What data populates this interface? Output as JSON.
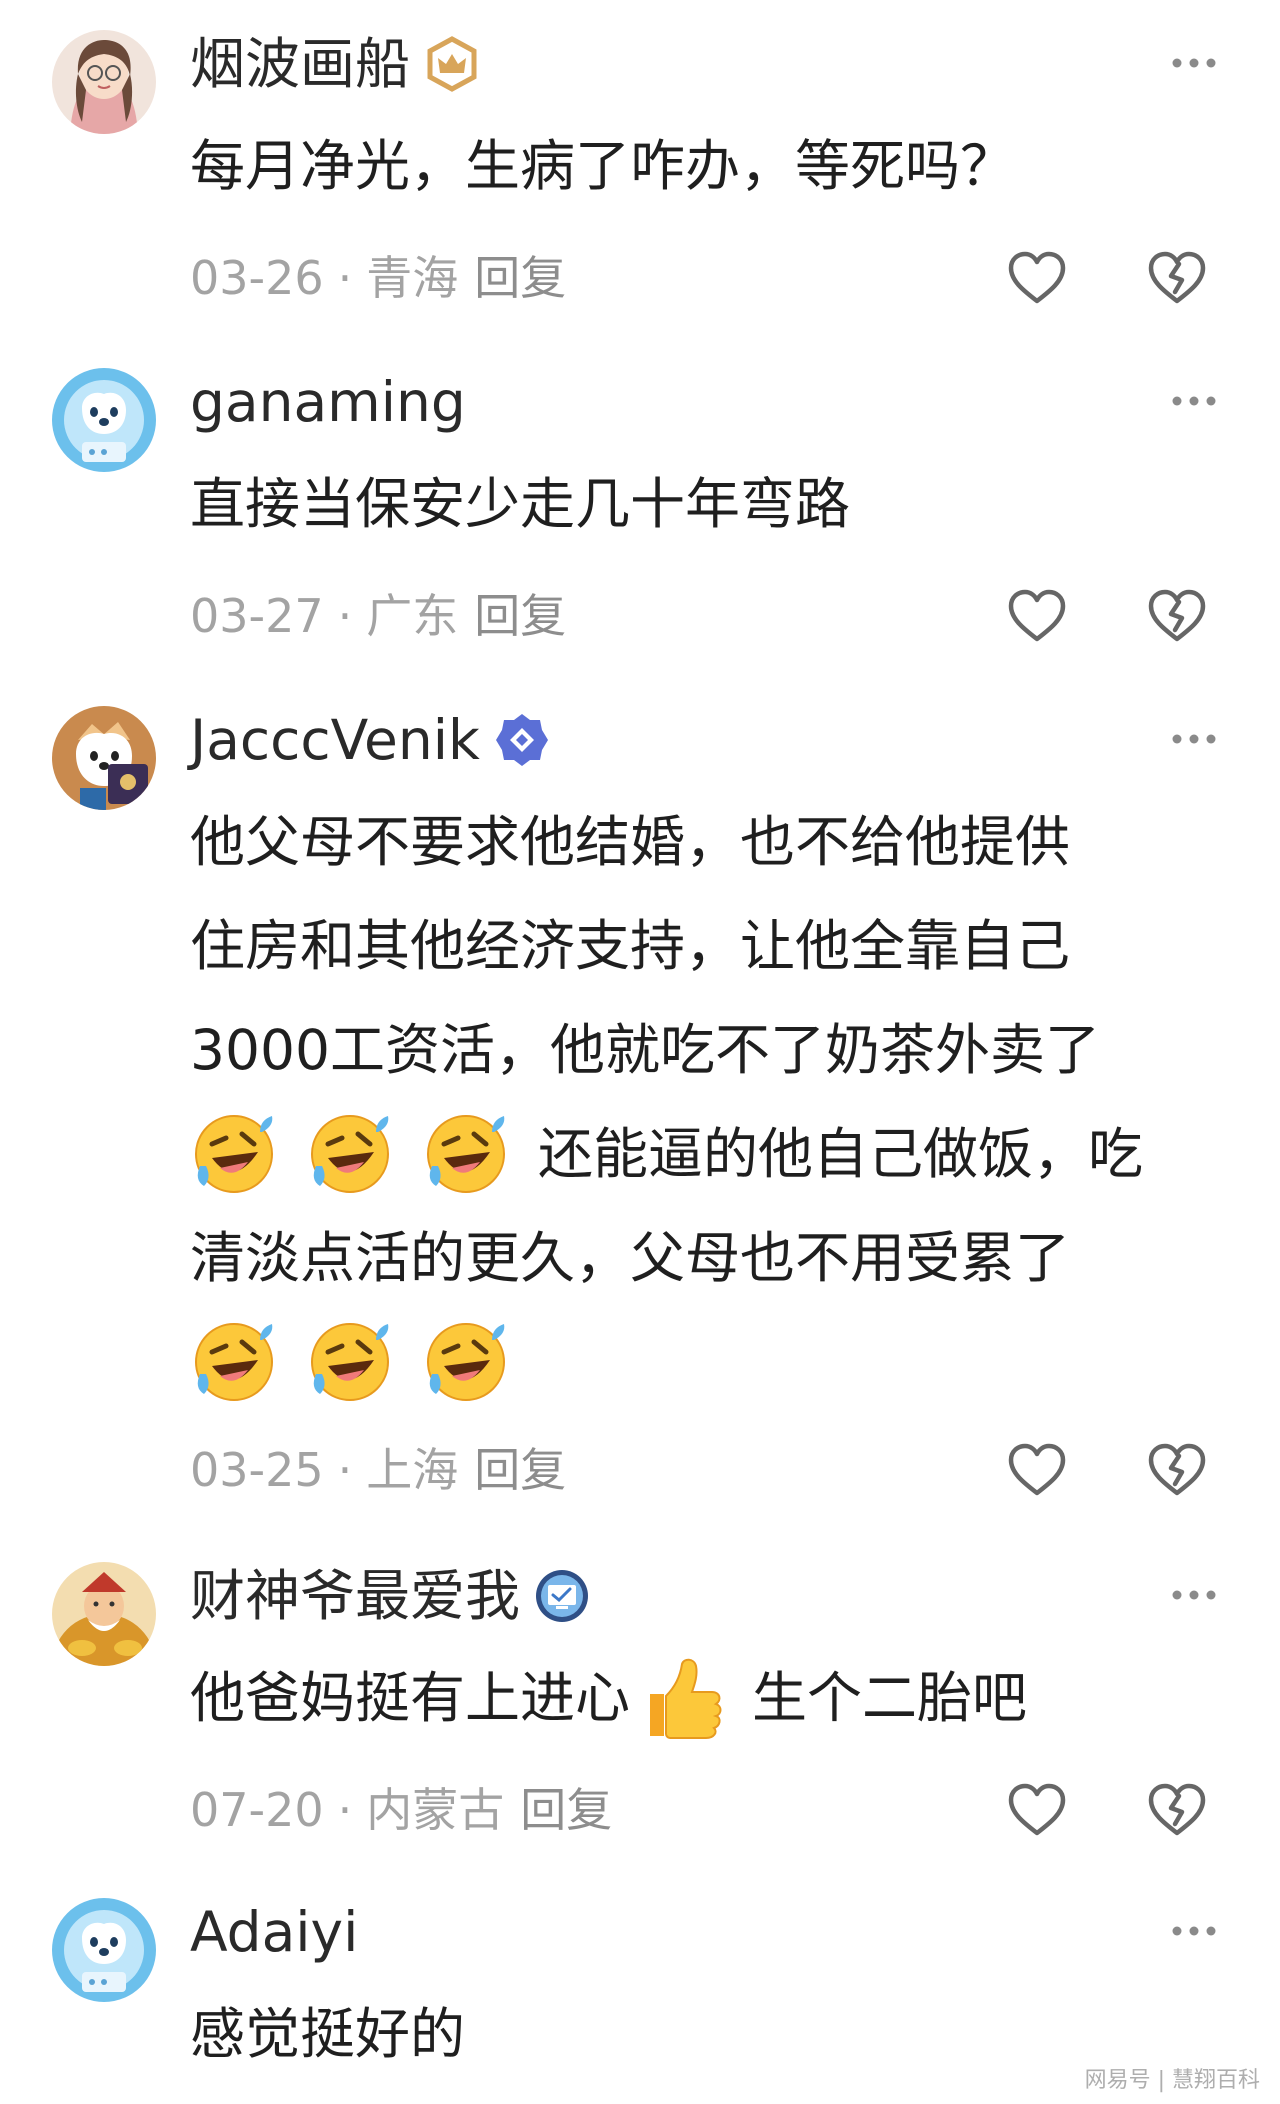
{
  "comments": [
    {
      "username": "烟波画船",
      "badge_icon": "crown-badge-icon",
      "lines": [
        "每月净光，生病了咋办，等死吗？"
      ],
      "date": "03-26",
      "location": "青海",
      "reply_label": "回复"
    },
    {
      "username": "ganaming",
      "lines": [
        "直接当保安少走几十年弯路"
      ],
      "date": "03-27",
      "location": "广东",
      "reply_label": "回复"
    },
    {
      "username": "JacccVenik",
      "badge_icon": "verified-badge-icon",
      "lines": [
        "他父母不要求他结婚，也不给他提供",
        "住房和其他经济支持，让他全靠自己",
        "3000工资活，他就吃不了奶茶外卖了",
        "还能逼的他自己做饭，吃",
        "清淡点活的更久，父母也不用受累了"
      ],
      "date": "03-25",
      "location": "上海",
      "reply_label": "回复"
    },
    {
      "username": "财神爷最爱我",
      "badge_icon": "message-badge-icon",
      "lines": [
        "他爸妈挺有上进心",
        "生个二胎吧"
      ],
      "date": "07-20",
      "location": "内蒙古",
      "reply_label": "回复"
    },
    {
      "username": "Adaiyi",
      "lines": [
        "感觉挺好的"
      ]
    }
  ],
  "separator": "·",
  "watermark": "网易号 | 慧翔百科",
  "colors": {
    "text": "#1f1f1f",
    "meta": "#a3a3a3",
    "icon_outline": "#666666",
    "verified_blue": "#5b6fd6",
    "crown_gold": "#d8a55a"
  }
}
